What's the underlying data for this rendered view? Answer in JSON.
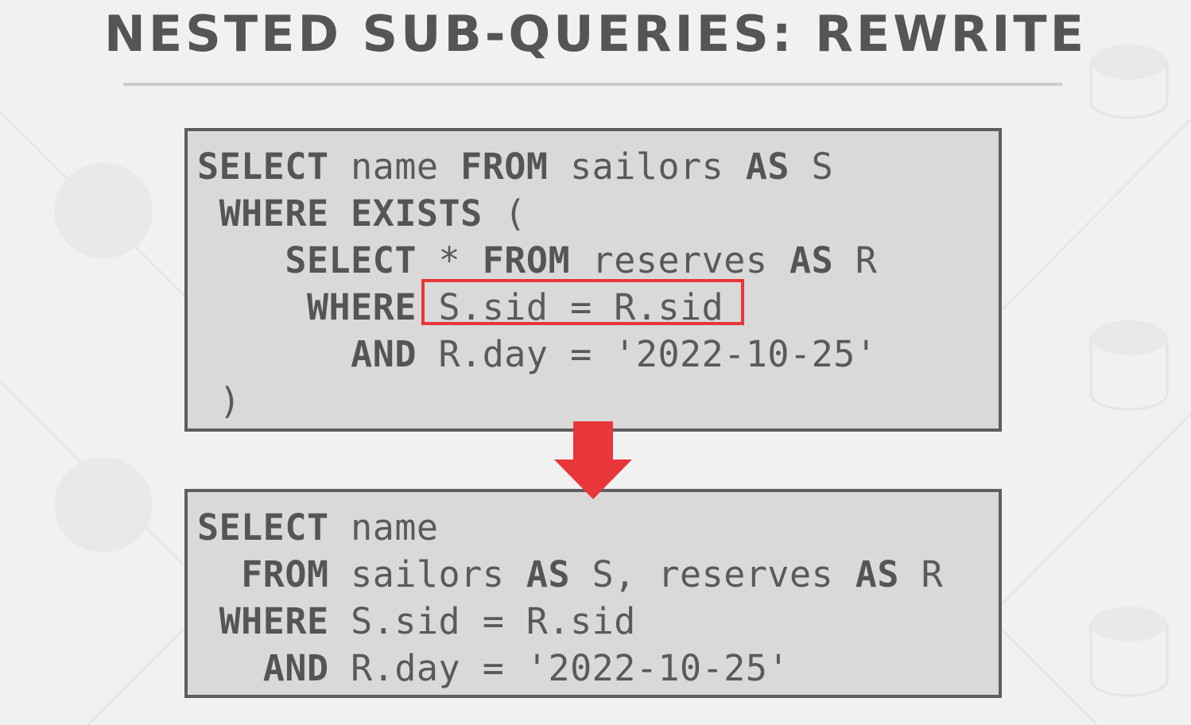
{
  "slide": {
    "title": "NESTED SUB-QUERIES: REWRITE"
  },
  "colors": {
    "background": "#f1f1f1",
    "box_fill": "#d9d9d9",
    "box_border": "#5e5e5e",
    "text": "#555555",
    "highlight": "#e8363a",
    "arrow": "#e8363a"
  },
  "original_query": {
    "line1": {
      "kw1": "SELECT",
      "t1": " name ",
      "kw2": "FROM",
      "t2": " sailors ",
      "kw3": "AS",
      "t3": " S"
    },
    "line2": {
      "kw1": "WHERE",
      "t1": " ",
      "kw2": "EXISTS",
      "t2": " ("
    },
    "line3": {
      "kw1": "SELECT",
      "t1": " * ",
      "kw2": "FROM",
      "t2": " reserves ",
      "kw3": "AS",
      "t3": " R"
    },
    "line4": {
      "kw1": "WHERE",
      "t1": " S.sid = R.sid"
    },
    "line5": {
      "kw1": "AND",
      "t1": " R.day = '2022-10-25'"
    },
    "line6": {
      "t1": ")"
    }
  },
  "rewritten_query": {
    "line1": {
      "kw1": "SELECT",
      "t1": " name"
    },
    "line2": {
      "kw1": "FROM",
      "t1": " sailors ",
      "kw2": "AS",
      "t2": " S, reserves ",
      "kw3": "AS",
      "t3": " R"
    },
    "line3": {
      "kw1": "WHERE",
      "t1": " S.sid = R.sid"
    },
    "line4": {
      "kw1": "AND",
      "t1": " R.day = '2022-10-25'"
    }
  },
  "icons": {
    "arrow": "down-arrow-icon",
    "highlight": "highlight-box"
  }
}
